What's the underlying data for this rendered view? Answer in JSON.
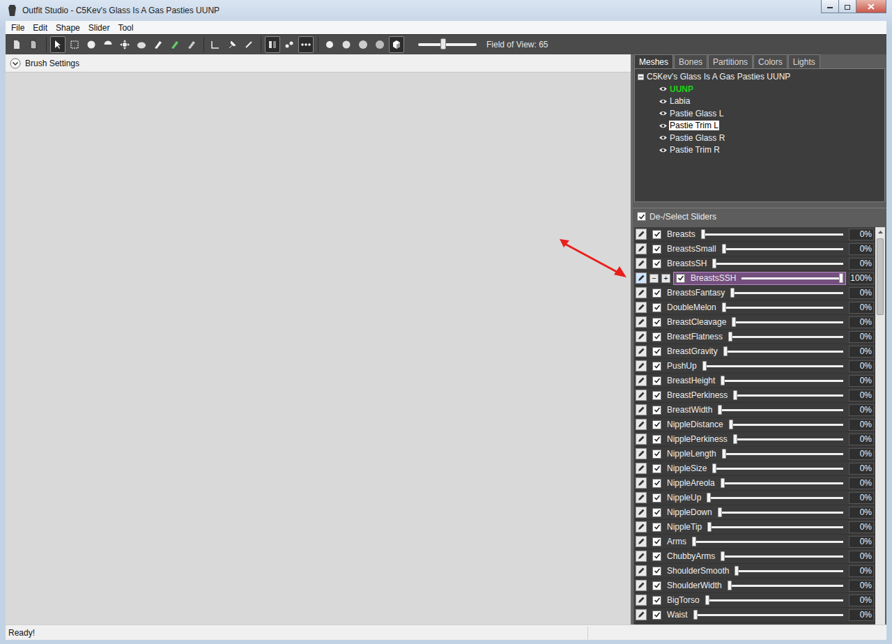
{
  "window": {
    "title": "Outfit Studio - C5Kev's Glass Is A Gas Pasties UUNP"
  },
  "menu": [
    "File",
    "Edit",
    "Shape",
    "Slider",
    "Tool"
  ],
  "toolbar": {
    "tools": [
      {
        "selected": false
      },
      {
        "selected": false
      },
      {
        "selected": true
      },
      {
        "selected": false
      },
      {
        "selected": false
      },
      {
        "selected": false
      },
      {
        "selected": false
      },
      {
        "selected": false
      },
      {
        "selected": false
      },
      {
        "selected": false
      },
      {
        "selected": false
      },
      {
        "selected": false
      },
      {
        "selected": false
      },
      {
        "selected": false
      },
      {
        "selected": true
      },
      {
        "selected": false
      },
      {
        "selected": true
      },
      {
        "selected": false
      },
      {
        "selected": false
      },
      {
        "selected": false
      },
      {
        "selected": false
      },
      {
        "selected": true
      }
    ],
    "fieldOfView": {
      "label": "Field of View: 65",
      "level": 0.43
    }
  },
  "viewport": {
    "header": "Brush Settings",
    "expanded": false
  },
  "panel": {
    "tabs": [
      {
        "label": "Meshes",
        "selected": true
      },
      {
        "label": "Bones",
        "selected": false
      },
      {
        "label": "Partitions",
        "selected": false
      },
      {
        "label": "Colors",
        "selected": false
      },
      {
        "label": "Lights",
        "selected": false
      }
    ],
    "tree": {
      "root": "C5Kev's Glass Is A Gas Pasties UUNP",
      "expanded": true,
      "items": [
        {
          "label": "UUNP",
          "active": true,
          "selected": false,
          "visible": true
        },
        {
          "label": "Labia",
          "active": false,
          "selected": false,
          "visible": true
        },
        {
          "label": "Pastie Glass L",
          "active": false,
          "selected": false,
          "visible": true
        },
        {
          "label": "Pastie Trim L",
          "active": false,
          "selected": true,
          "visible": true
        },
        {
          "label": "Pastie Glass R",
          "active": false,
          "selected": false,
          "visible": true
        },
        {
          "label": "Pastie Trim R",
          "active": false,
          "selected": false,
          "visible": true
        }
      ]
    }
  },
  "sliders": {
    "header": "De-/Select Sliders",
    "allChecked": true,
    "stepButtons": [
      "−",
      "+"
    ],
    "items": [
      {
        "name": "Breasts",
        "checked": true,
        "selected": false,
        "level": 0,
        "reading": "0%"
      },
      {
        "name": "BreastsSmall",
        "checked": true,
        "selected": false,
        "level": 0,
        "reading": "0%"
      },
      {
        "name": "BreastsSH",
        "checked": true,
        "selected": false,
        "level": 0,
        "reading": "0%"
      },
      {
        "name": "BreastsSSH",
        "checked": true,
        "selected": true,
        "level": 1,
        "reading": "100%"
      },
      {
        "name": "BreastsFantasy",
        "checked": true,
        "selected": false,
        "level": 0,
        "reading": "0%"
      },
      {
        "name": "DoubleMelon",
        "checked": true,
        "selected": false,
        "level": 0,
        "reading": "0%"
      },
      {
        "name": "BreastCleavage",
        "checked": true,
        "selected": false,
        "level": 0,
        "reading": "0%"
      },
      {
        "name": "BreastFlatness",
        "checked": true,
        "selected": false,
        "level": 0,
        "reading": "0%"
      },
      {
        "name": "BreastGravity",
        "checked": true,
        "selected": false,
        "level": 0,
        "reading": "0%"
      },
      {
        "name": "PushUp",
        "checked": true,
        "selected": false,
        "level": 0,
        "reading": "0%"
      },
      {
        "name": "BreastHeight",
        "checked": true,
        "selected": false,
        "level": 0,
        "reading": "0%"
      },
      {
        "name": "BreastPerkiness",
        "checked": true,
        "selected": false,
        "level": 0,
        "reading": "0%"
      },
      {
        "name": "BreastWidth",
        "checked": true,
        "selected": false,
        "level": 0,
        "reading": "0%"
      },
      {
        "name": "NippleDistance",
        "checked": true,
        "selected": false,
        "level": 0,
        "reading": "0%"
      },
      {
        "name": "NipplePerkiness",
        "checked": true,
        "selected": false,
        "level": 0,
        "reading": "0%"
      },
      {
        "name": "NippleLength",
        "checked": true,
        "selected": false,
        "level": 0,
        "reading": "0%"
      },
      {
        "name": "NippleSize",
        "checked": true,
        "selected": false,
        "level": 0,
        "reading": "0%"
      },
      {
        "name": "NippleAreola",
        "checked": true,
        "selected": false,
        "level": 0,
        "reading": "0%"
      },
      {
        "name": "NippleUp",
        "checked": true,
        "selected": false,
        "level": 0,
        "reading": "0%"
      },
      {
        "name": "NippleDown",
        "checked": true,
        "selected": false,
        "level": 0,
        "reading": "0%"
      },
      {
        "name": "NippleTip",
        "checked": true,
        "selected": false,
        "level": 0,
        "reading": "0%"
      },
      {
        "name": "Arms",
        "checked": true,
        "selected": false,
        "level": 0,
        "reading": "0%"
      },
      {
        "name": "ChubbyArms",
        "checked": true,
        "selected": false,
        "level": 0,
        "reading": "0%"
      },
      {
        "name": "ShoulderSmooth",
        "checked": true,
        "selected": false,
        "level": 0,
        "reading": "0%"
      },
      {
        "name": "ShoulderWidth",
        "checked": true,
        "selected": false,
        "level": 0,
        "reading": "0%"
      },
      {
        "name": "BigTorso",
        "checked": true,
        "selected": false,
        "level": 0,
        "reading": "0%"
      },
      {
        "name": "Waist",
        "checked": true,
        "selected": false,
        "level": 0,
        "reading": "0%"
      }
    ]
  },
  "status_bar": "Ready!"
}
